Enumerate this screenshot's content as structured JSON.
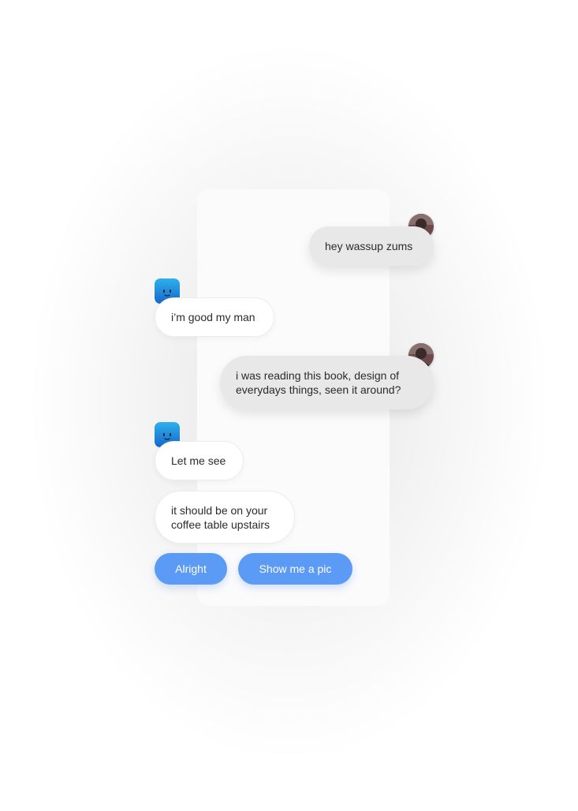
{
  "messages": [
    {
      "sender": "user",
      "text": "hey wassup zums"
    },
    {
      "sender": "bot",
      "text": "i’m good my man"
    },
    {
      "sender": "user",
      "text": "i was reading this book, design of\neverydays things, seen it around?"
    },
    {
      "sender": "bot",
      "text": "Let me see"
    },
    {
      "sender": "bot",
      "text": "it should be on your\ncoffee table upstairs"
    }
  ],
  "quick_replies": [
    "Alright",
    "Show me a pic"
  ],
  "colors": {
    "user_bubble": "#e8e8e8",
    "bot_bubble": "#ffffff",
    "quick_reply": "#5b9af5",
    "bot_avatar_top": "#2fb0ee",
    "bot_avatar_bottom": "#1567c9"
  },
  "icons": {
    "user_avatar": "user-photo-avatar",
    "bot_avatar": "smiley-square-avatar"
  }
}
